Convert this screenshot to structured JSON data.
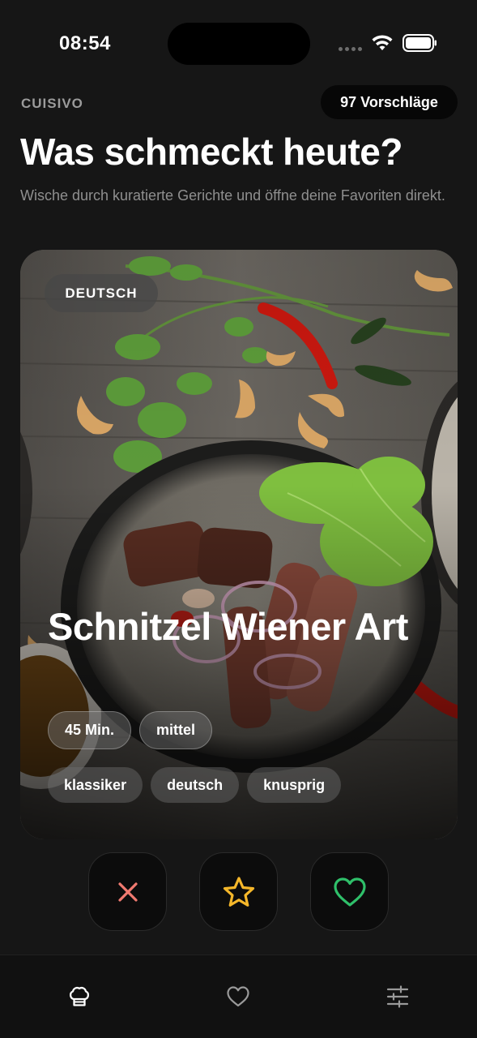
{
  "status_bar": {
    "time": "08:54"
  },
  "header": {
    "brand": "CUISIVO",
    "suggestions_count": "97 Vorschläge",
    "title": "Was schmeckt heute?",
    "subtitle": "Wische durch kuratierte Gerichte und öffne deine Favoriten direkt."
  },
  "card": {
    "cuisine": "DEUTSCH",
    "dish_name": "Schnitzel Wiener Art",
    "meta_chips": [
      "45 Min.",
      "mittel"
    ],
    "tags": [
      "klassiker",
      "deutsch",
      "knusprig"
    ]
  },
  "actions": {
    "dismiss_icon": "x-icon",
    "favorite_icon": "star-icon",
    "like_icon": "heart-icon"
  },
  "tabbar": {
    "items": [
      {
        "icon": "chef-hat-icon",
        "active": true
      },
      {
        "icon": "heart-icon",
        "active": false
      },
      {
        "icon": "sliders-icon",
        "active": false
      }
    ]
  },
  "colors": {
    "background": "#161616",
    "dismiss": "#f07a70",
    "favorite": "#f5b72a",
    "like": "#2fc06a"
  }
}
